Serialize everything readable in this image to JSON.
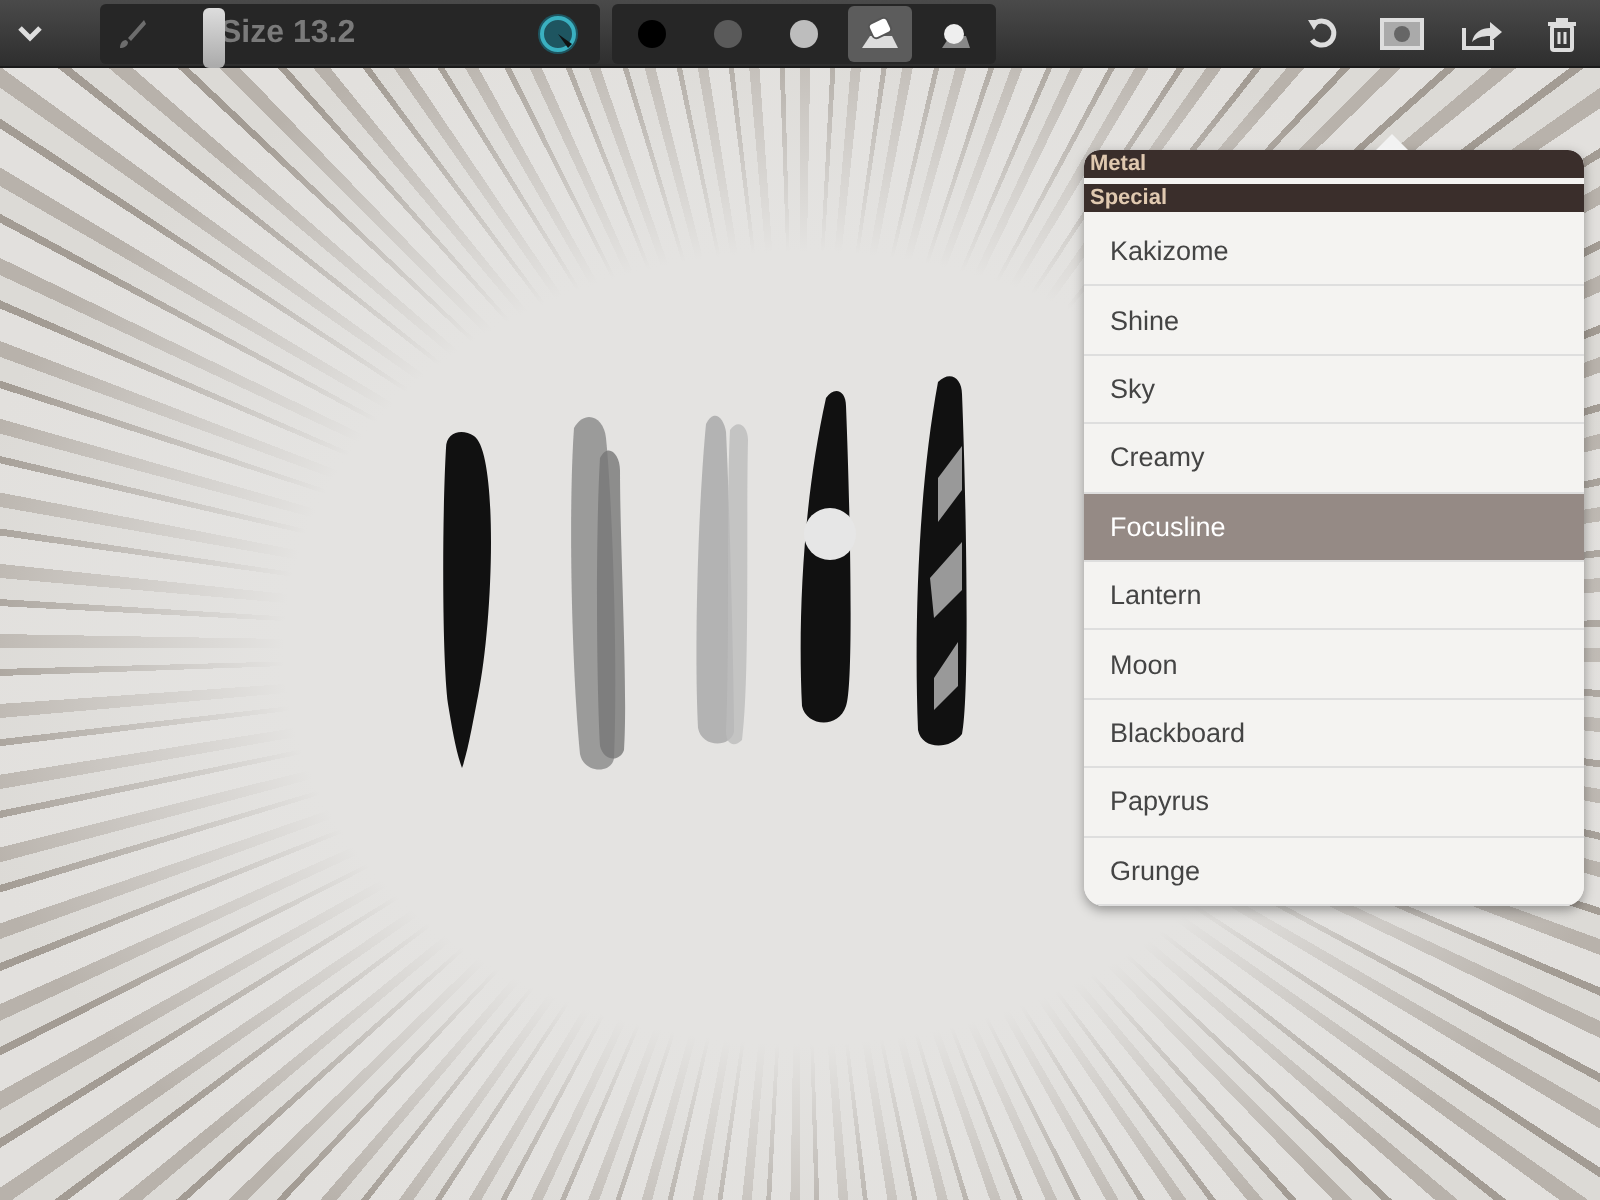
{
  "toolbar": {
    "brush_size": {
      "label": "Size 13.2",
      "level": 0.26
    },
    "tools": [
      {
        "kind": "dot",
        "color": "#000000",
        "selected": false
      },
      {
        "kind": "dot",
        "color": "#5a5a5a",
        "selected": false
      },
      {
        "kind": "dot",
        "color": "#bdbdbd",
        "selected": false
      },
      {
        "kind": "eraser",
        "selected": true
      },
      {
        "kind": "smudge",
        "selected": false
      }
    ]
  },
  "paper_menu": {
    "sections": [
      {
        "title": "Metal"
      },
      {
        "title": "Special"
      }
    ],
    "items": [
      {
        "label": "Kakizome",
        "selected": false
      },
      {
        "label": "Shine",
        "selected": false
      },
      {
        "label": "Sky",
        "selected": false
      },
      {
        "label": "Creamy",
        "selected": false
      },
      {
        "label": "Focusline",
        "selected": true
      },
      {
        "label": "Lantern",
        "selected": false
      },
      {
        "label": "Moon",
        "selected": false
      },
      {
        "label": "Blackboard",
        "selected": false
      },
      {
        "label": "Papyrus",
        "selected": false
      },
      {
        "label": "Grunge",
        "selected": false
      }
    ]
  }
}
